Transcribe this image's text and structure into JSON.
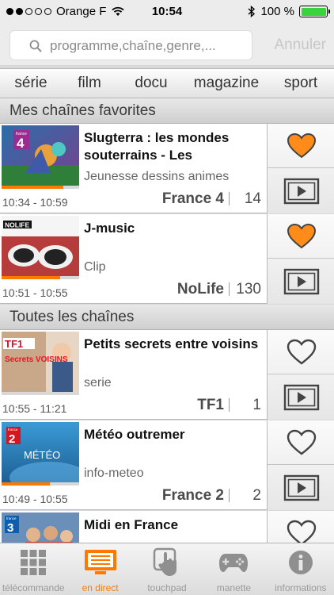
{
  "status_bar": {
    "carrier": "Orange F",
    "time": "10:54",
    "battery": "100 %"
  },
  "search": {
    "placeholder": "programme,chaîne,genre,...",
    "cancel_label": "Annuler"
  },
  "genres": [
    "série",
    "film",
    "docu",
    "magazine",
    "sport"
  ],
  "sections": {
    "favorites_title": "Mes chaînes favorites",
    "all_title": "Toutes les chaînes"
  },
  "favorites": [
    {
      "title": "Slugterra : les mondes souterrains - Les",
      "genre": "Jeunesse dessins animes",
      "time": "10:34 - 10:59",
      "channel": "France 4",
      "number": "14",
      "favorite": true,
      "progress": 0.8,
      "logo": "4"
    },
    {
      "title": "J-music",
      "genre": "Clip",
      "time": "10:51 - 10:55",
      "channel": "NoLife",
      "number": "130",
      "favorite": true,
      "progress": 0.75,
      "logo": "NOLIFE"
    }
  ],
  "all_channels": [
    {
      "title": "Petits secrets entre voisins",
      "genre": "serie",
      "time": "10:55 - 11:21",
      "channel": "TF1",
      "number": "1",
      "favorite": false,
      "progress": 0.0,
      "logo": "TF1",
      "thumb_text": "Secrets VOISINS"
    },
    {
      "title": "Météo outremer",
      "genre": "info-meteo",
      "time": "10:49 - 10:55",
      "channel": "France 2",
      "number": "2",
      "favorite": false,
      "progress": 0.62,
      "logo": "2",
      "thumb_text": "MÉTÉO"
    },
    {
      "title": "Midi en France",
      "genre": "",
      "time": "",
      "channel": "",
      "number": "",
      "favorite": false,
      "progress": 0.0,
      "logo": "3"
    }
  ],
  "tabbar": [
    {
      "label": "télécommande",
      "icon": "remote-grid-icon",
      "active": false
    },
    {
      "label": "en direct",
      "icon": "tv-live-icon",
      "active": true
    },
    {
      "label": "touchpad",
      "icon": "touchpad-hand-icon",
      "active": false
    },
    {
      "label": "manette",
      "icon": "gamepad-icon",
      "active": false
    },
    {
      "label": "informations",
      "icon": "info-icon",
      "active": false
    }
  ],
  "colors": {
    "accent": "#ff7900",
    "heart_fill": "#ff8c1a"
  }
}
